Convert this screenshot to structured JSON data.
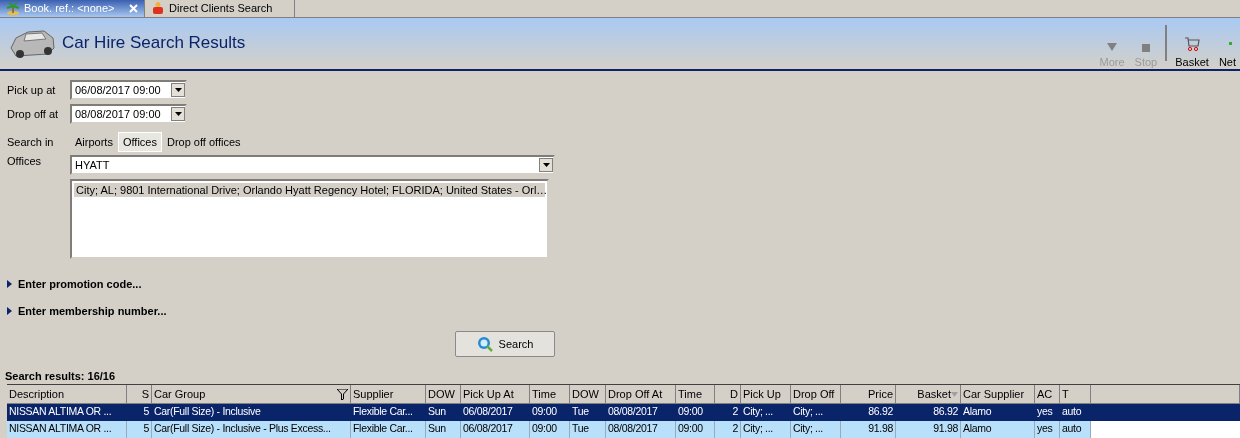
{
  "tabs": [
    {
      "label": "Book. ref.: <none>",
      "selected": true,
      "kind": "booking",
      "closable": true
    },
    {
      "label": "Direct Clients Search",
      "selected": false,
      "kind": "clients",
      "closable": false
    }
  ],
  "header": {
    "title": "Car Hire Search Results"
  },
  "toolbar": [
    {
      "label": "More",
      "kind": "more",
      "disabled": true
    },
    {
      "label": "Stop",
      "kind": "stop",
      "disabled": true
    },
    {
      "label": "Basket",
      "kind": "basket",
      "disabled": false
    },
    {
      "label": "Net",
      "kind": "net",
      "disabled": false
    }
  ],
  "form": {
    "pick_up": {
      "label": "Pick up at",
      "value": "06/08/2017 09:00"
    },
    "drop_off": {
      "label": "Drop off at",
      "value": "08/08/2017 09:00"
    },
    "search_in": {
      "label": "Search in",
      "options": [
        {
          "label": "Airports",
          "selected": false
        },
        {
          "label": "Offices",
          "selected": true
        },
        {
          "label": "Drop off offices",
          "selected": false
        }
      ]
    },
    "offices": {
      "label": "Offices",
      "value": "HYATT",
      "results": [
        {
          "text": "City; AL; 9801 International Drive; Orlando Hyatt Regency Hotel; FLORIDA; United States - Orl…",
          "selected": true
        }
      ]
    },
    "expanders": [
      {
        "label": "Enter promotion code...",
        "expanded": false
      },
      {
        "label": "Enter membership number...",
        "expanded": false
      }
    ],
    "search_button": "Search"
  },
  "results": {
    "title": "Search results: 16/16",
    "columns": [
      {
        "label": "Description",
        "kind": "text"
      },
      {
        "label": "S",
        "kind": "number"
      },
      {
        "label": "Car Group",
        "kind": "filtered"
      },
      {
        "label": "Supplier",
        "kind": "text"
      },
      {
        "label": "DOW",
        "kind": "text"
      },
      {
        "label": "Pick Up At",
        "kind": "text"
      },
      {
        "label": "Time",
        "kind": "text"
      },
      {
        "label": "DOW",
        "kind": "text"
      },
      {
        "label": "Drop Off At",
        "kind": "text"
      },
      {
        "label": "Time",
        "kind": "text"
      },
      {
        "label": "D",
        "kind": "number"
      },
      {
        "label": "Pick Up",
        "kind": "text"
      },
      {
        "label": "Drop Off",
        "kind": "text"
      },
      {
        "label": "Price",
        "kind": "number"
      },
      {
        "label": "Basket",
        "kind": "sorted"
      },
      {
        "label": "Car Supplier",
        "kind": "text"
      },
      {
        "label": "AC",
        "kind": "text"
      },
      {
        "label": "T",
        "kind": "text"
      }
    ],
    "rows": [
      {
        "selected": true,
        "cells": [
          "NISSAN ALTIMA OR ...",
          "5",
          "Car(Full Size) - Inclusive",
          "Flexible Car...",
          "Sun",
          "06/08/2017",
          "09:00",
          "Tue",
          "08/08/2017",
          "09:00",
          "2",
          "City; ...",
          "City; ...",
          "86.92",
          "86.92",
          "Alamo",
          "yes",
          "auto"
        ]
      },
      {
        "selected": false,
        "cells": [
          "NISSAN ALTIMA OR ...",
          "5",
          "Car(Full Size) - Inclusive - Plus Excess...",
          "Flexible Car...",
          "Sun",
          "06/08/2017",
          "09:00",
          "Tue",
          "08/08/2017",
          "09:00",
          "2",
          "City; ...",
          "City; ...",
          "91.98",
          "91.98",
          "Alamo",
          "yes",
          "auto"
        ]
      }
    ]
  }
}
